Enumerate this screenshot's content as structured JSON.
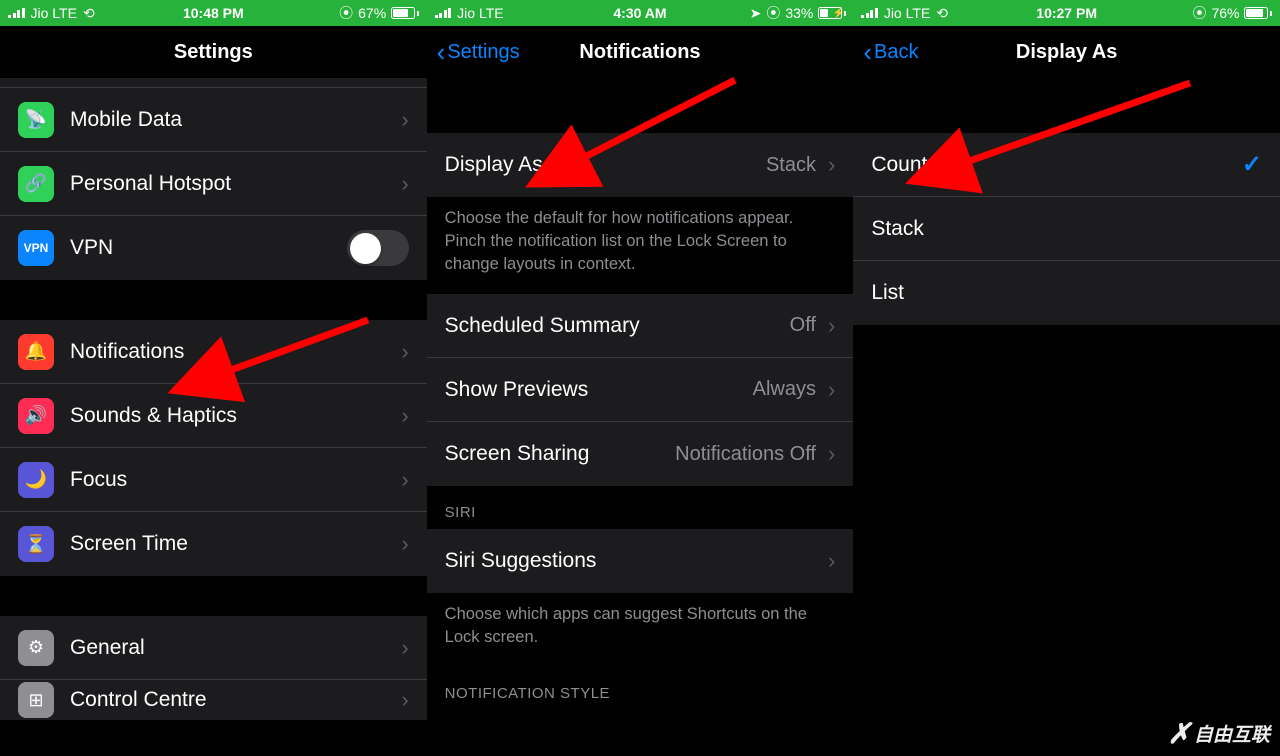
{
  "screen1": {
    "status": {
      "carrier": "Jio  LTE",
      "time": "10:48 PM",
      "battery_pct": "67%",
      "battery_fill": 67,
      "nav_icon": true
    },
    "header": {
      "title": "Settings"
    },
    "group1": [
      {
        "icon": "mobile-data-icon",
        "iconBg": "#30d158",
        "glyph": "(📶)",
        "label": "Mobile Data",
        "chevron": true
      },
      {
        "icon": "hotspot-icon",
        "iconBg": "#30d158",
        "glyph": "🔗",
        "label": "Personal Hotspot",
        "chevron": true
      },
      {
        "icon": "vpn-icon",
        "iconBg": "#0a84ff",
        "glyph": "VPN",
        "label": "VPN",
        "toggle": true,
        "toggleOn": false
      }
    ],
    "group2": [
      {
        "icon": "notifications-icon",
        "iconBg": "#ff3b30",
        "glyph": "🔔",
        "label": "Notifications",
        "chevron": true
      },
      {
        "icon": "sounds-icon",
        "iconBg": "#ff2d55",
        "glyph": "🔊",
        "label": "Sounds & Haptics",
        "chevron": true
      },
      {
        "icon": "focus-icon",
        "iconBg": "#5856d6",
        "glyph": "🌙",
        "label": "Focus",
        "chevron": true
      },
      {
        "icon": "screentime-icon",
        "iconBg": "#5856d6",
        "glyph": "⏳",
        "label": "Screen Time",
        "chevron": true
      }
    ],
    "group3": [
      {
        "icon": "general-icon",
        "iconBg": "#8e8e93",
        "glyph": "⚙",
        "label": "General",
        "chevron": true
      },
      {
        "icon": "control-centre-icon",
        "iconBg": "#8e8e93",
        "glyph": "⊞",
        "label": "Control Centre",
        "chevron": true
      }
    ]
  },
  "screen2": {
    "status": {
      "carrier": "Jio  LTE",
      "time": "4:30 AM",
      "battery_pct": "33%",
      "battery_fill": 33,
      "charging": true,
      "loc_icon": true
    },
    "header": {
      "back": "Settings",
      "title": "Notifications"
    },
    "row_display_as": {
      "label": "Display As",
      "value": "Stack"
    },
    "footer_display": "Choose the default for how notifications appear. Pinch the notification list on the Lock Screen to change layouts in context.",
    "rows2": [
      {
        "label": "Scheduled Summary",
        "value": "Off"
      },
      {
        "label": "Show Previews",
        "value": "Always"
      },
      {
        "label": "Screen Sharing",
        "value": "Notifications Off"
      }
    ],
    "siri_label": "SIRI",
    "siri_row": {
      "label": "Siri Suggestions"
    },
    "footer_siri": "Choose which apps can suggest Shortcuts on the Lock screen.",
    "style_label": "NOTIFICATION STYLE"
  },
  "screen3": {
    "status": {
      "carrier": "Jio  LTE",
      "time": "10:27 PM",
      "battery_pct": "76%",
      "battery_fill": 76,
      "nav_icon": true
    },
    "header": {
      "back": "Back",
      "title": "Display As"
    },
    "options": [
      {
        "label": "Count",
        "checked": true
      },
      {
        "label": "Stack",
        "checked": false
      },
      {
        "label": "List",
        "checked": false
      }
    ]
  },
  "watermark": "自由互联"
}
